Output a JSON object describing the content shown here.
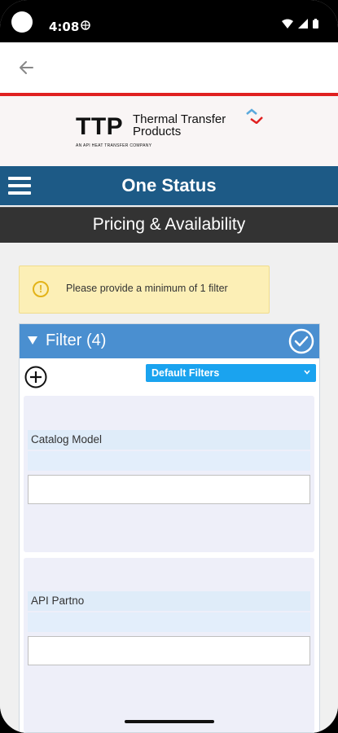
{
  "status_bar": {
    "time": "4:08"
  },
  "logo": {
    "short": "TTP",
    "name_line1": "Thermal Transfer",
    "name_line2": "Products",
    "tagline": "AN API HEAT TRANSFER COMPANY"
  },
  "nav": {
    "title": "One Status"
  },
  "subheader": {
    "title": "Pricing & Availability"
  },
  "notice": {
    "text": "Please provide a minimum of 1 filter"
  },
  "filter": {
    "title": "Filter (4)",
    "dropdown_selected": "Default Filters",
    "fields": [
      {
        "label": "Catalog Model",
        "value": ""
      },
      {
        "label": "API Partno",
        "value": ""
      }
    ]
  },
  "colors": {
    "nav_bar": "#1d5a86",
    "filter_header": "#4a8fd0",
    "dropdown": "#1aa3ef",
    "notice_bg": "#fcefb6",
    "accent_red": "#e02020"
  }
}
